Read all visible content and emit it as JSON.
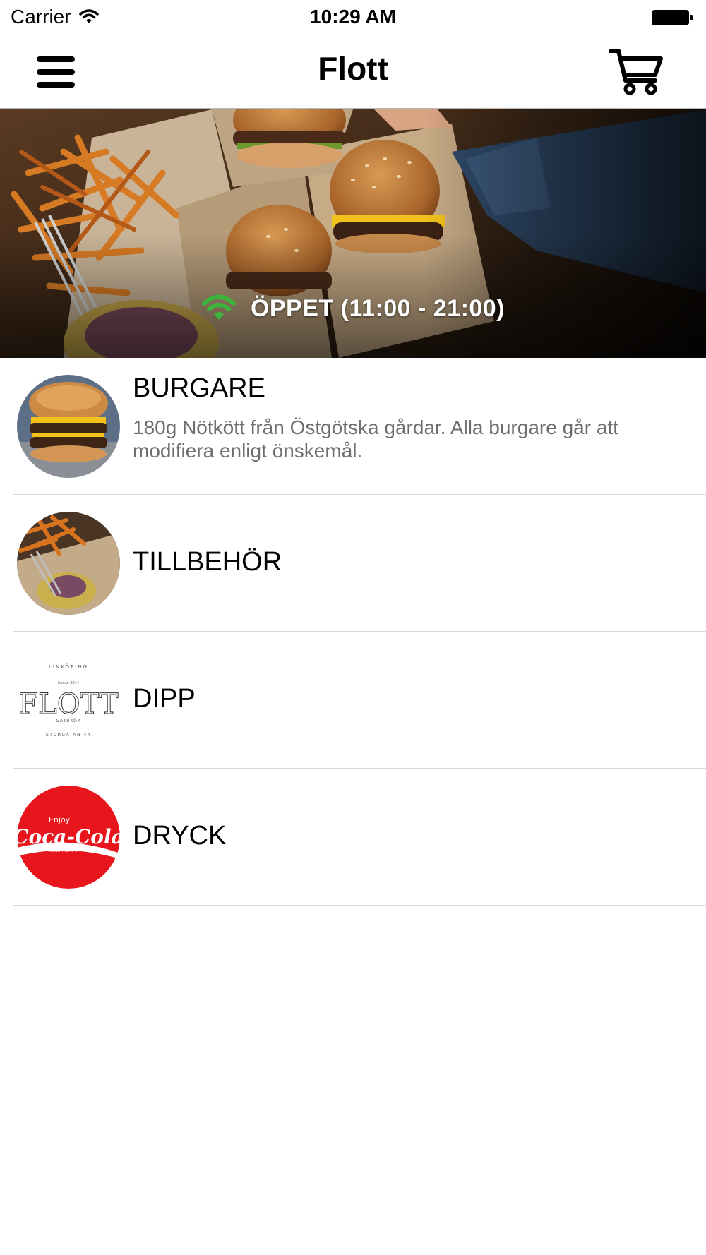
{
  "status_bar": {
    "carrier": "Carrier",
    "time": "10:29 AM",
    "wifi_icon": "wifi-icon",
    "battery_icon": "battery-icon"
  },
  "nav": {
    "title": "Flott",
    "menu_icon": "hamburger-menu-icon",
    "cart_icon": "shopping-cart-icon"
  },
  "hero": {
    "status_text": "ÖPPET (11:00 - 21:00)",
    "status_icon": "wifi-signal-icon",
    "status_color": "#3cb43c"
  },
  "categories": [
    {
      "name": "BURGARE",
      "description": "180g Nötkött från Östgötska gårdar. Alla burgare går att modifiera enligt önskemål."
    },
    {
      "name": "TILLBEHÖR"
    },
    {
      "name": "DIPP",
      "logo": {
        "top": "LINKÖPING",
        "since": "Sedan 2014",
        "word": "FLOTT",
        "sub": "GATUKÖK",
        "bottom": "STORGATAN 44"
      }
    },
    {
      "name": "DRYCK",
      "logo": {
        "enjoy": "Enjoy",
        "word": "Coca-Cola",
        "tm": "Trade-mark ®"
      }
    }
  ]
}
